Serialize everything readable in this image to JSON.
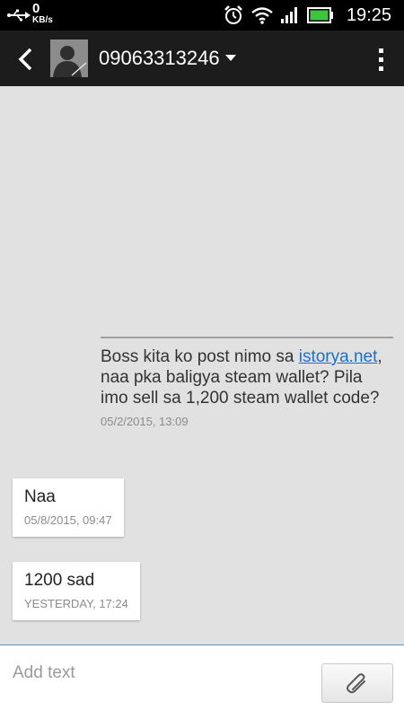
{
  "status_bar": {
    "data_rate_value": "0",
    "data_rate_unit": "KB/s",
    "time": "19:25",
    "battery_color": "#3ec43e"
  },
  "header": {
    "contact_name": "09063313246"
  },
  "messages": [
    {
      "direction": "outgoing",
      "text_before_link": "Boss kita ko post nimo sa ",
      "link_text": "istorya.net",
      "text_after_link": ", naa pka baligya steam wallet? Pila imo sell sa 1,200 steam wallet code?",
      "timestamp": "05/2/2015, 13:09"
    },
    {
      "direction": "incoming",
      "text": "Naa",
      "timestamp": "05/8/2015, 09:47"
    },
    {
      "direction": "incoming",
      "text": "1200 sad",
      "timestamp": "YESTERDAY, 17:24"
    }
  ],
  "composer": {
    "placeholder": "Add text"
  },
  "colors": {
    "header_bg": "#1c1c1c",
    "conversation_bg": "#e1e1e1",
    "link": "#1f6fc5"
  }
}
